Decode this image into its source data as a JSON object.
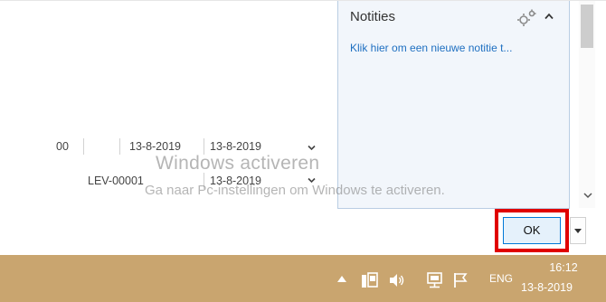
{
  "grid": {
    "row1": {
      "code": "00",
      "date1": "13-8-2019",
      "date2": "13-8-2019"
    },
    "row2": {
      "supplier": "LEV-00001",
      "date2": "13-8-2019"
    }
  },
  "notes_panel": {
    "title": "Notities",
    "new_note_link": "Klik hier om een nieuwe notitie t..."
  },
  "watermark": {
    "title": "Windows activeren",
    "subtitle": "Ga naar Pc-instellingen om Windows te activeren."
  },
  "dialog": {
    "ok_label": "OK"
  },
  "taskbar": {
    "color": "#c9a56f",
    "language": "ENG",
    "time": "16:12",
    "date": "13-8-2019",
    "tray_icons": [
      "show-hidden-icons-chevron-icon",
      "device-icon",
      "volume-icon",
      "network-icon",
      "action-center-flag-icon"
    ]
  },
  "colors": {
    "link": "#1e6fc1",
    "highlight": "#e00000",
    "button_border": "#0078d7"
  }
}
